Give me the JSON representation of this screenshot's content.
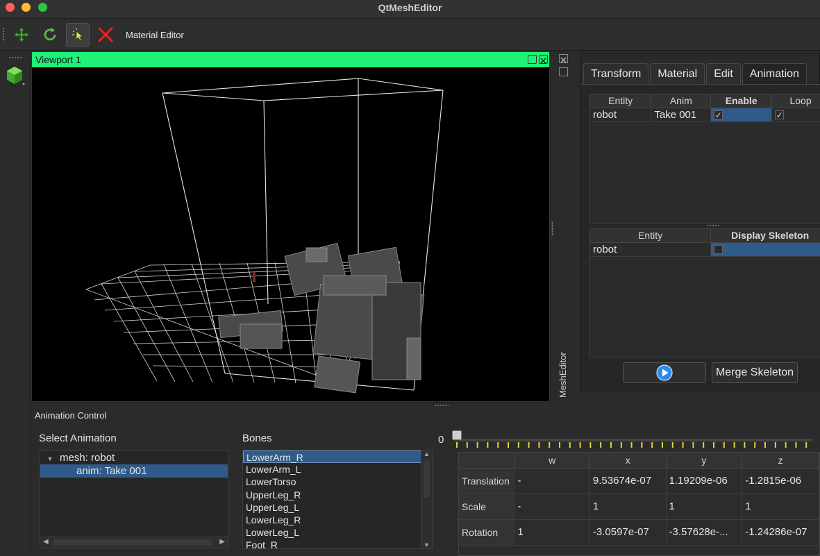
{
  "window": {
    "title": "QtMeshEditor"
  },
  "toolbar": {
    "material_editor_label": "Material Editor",
    "icons": [
      "move-icon",
      "rotate-icon",
      "select-icon",
      "delete-icon"
    ]
  },
  "viewport": {
    "title": "Viewport 1"
  },
  "dock": {
    "label": "MeshEditor"
  },
  "right_panel": {
    "tabs": [
      "Transform",
      "Material",
      "Edit",
      "Animation"
    ],
    "active_tab": "Animation",
    "anim_table": {
      "headers": [
        "Entity",
        "Anim",
        "Enable",
        "Loop"
      ],
      "rows": [
        {
          "entity": "robot",
          "anim": "Take 001",
          "enable": "✓",
          "loop": "✓"
        }
      ]
    },
    "skeleton_table": {
      "headers": [
        "Entity",
        "Display Skeleton"
      ],
      "rows": [
        {
          "entity": "robot"
        }
      ]
    },
    "merge_button": "Merge Skeleton"
  },
  "animation_control": {
    "title": "Animation Control",
    "select_label": "Select Animation",
    "tree": {
      "mesh": "mesh: robot",
      "anim": "anim: Take 001"
    },
    "bones_label": "Bones",
    "bones": [
      "LowerArm_R",
      "LowerArm_L",
      "LowerTorso",
      "UpperLeg_R",
      "UpperLeg_L",
      "LowerLeg_R",
      "LowerLeg_L",
      "Foot_R"
    ],
    "slider_value": "0",
    "transform": {
      "headers": [
        "",
        "w",
        "x",
        "y",
        "z"
      ],
      "rows": [
        [
          "Translation",
          "-",
          "9.53674e-07",
          "1.19209e-06",
          "-1.2815e-06"
        ],
        [
          "Scale",
          "-",
          "1",
          "1",
          "1"
        ],
        [
          "Rotation",
          "1",
          "-3.0597e-07",
          "-3.57628e-...",
          "-1.24286e-07"
        ]
      ]
    }
  },
  "colors": {
    "viewport_header": "#1ff07a",
    "selection": "#2f5a89",
    "tick": "#e2d23a"
  }
}
